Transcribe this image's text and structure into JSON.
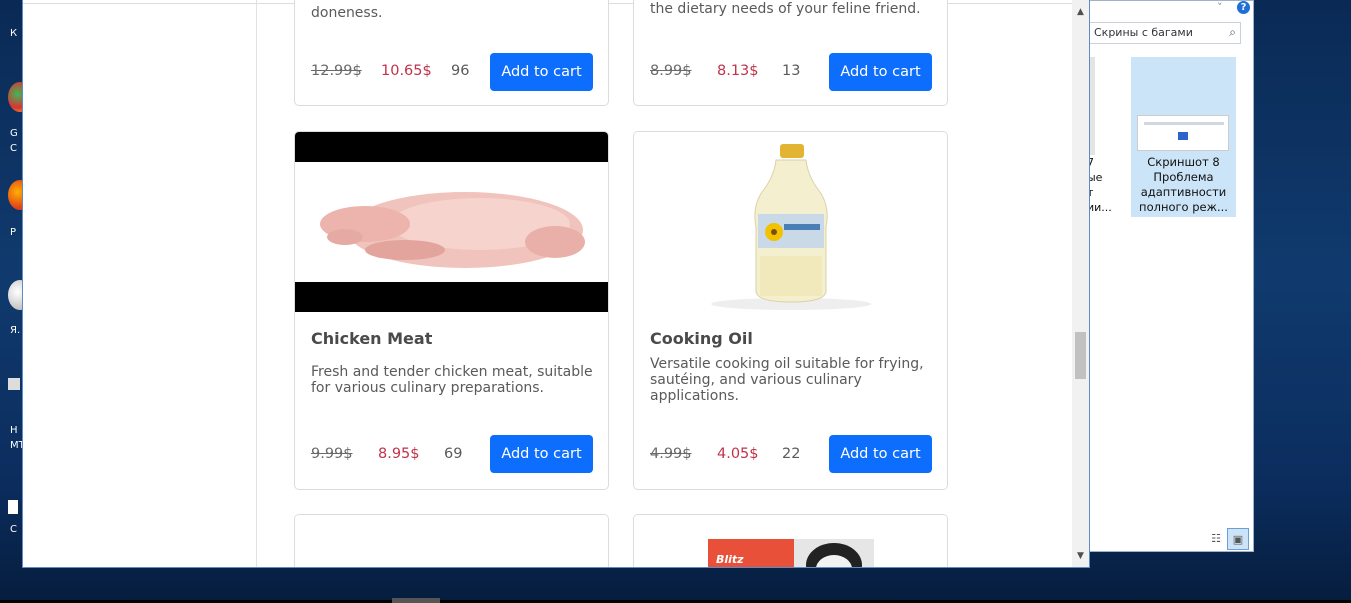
{
  "desktop": {
    "icon_labels": [
      "К",
      "G",
      "С",
      "Р",
      "Я.",
      "Н",
      "МТ",
      "С"
    ]
  },
  "explorer": {
    "search_placeholder": "Скрины с багами",
    "partial_item_caption": "7\nые\nт\nии...",
    "item": {
      "caption_line1": "Скриншот 8",
      "caption_line2": "Проблема",
      "caption_line3": "адаптивности",
      "caption_line4": "полного реж..."
    },
    "help_glyph": "?",
    "chevron_glyph": "˅"
  },
  "products": {
    "row_top": [
      {
        "desc_tail": "doneness.",
        "old_price": "12.99$",
        "new_price": "10.65$",
        "stock": "96",
        "button": "Add to cart"
      },
      {
        "desc_tail": "the dietary needs of your feline friend.",
        "old_price": "8.99$",
        "new_price": "8.13$",
        "stock": "13",
        "button": "Add to cart"
      }
    ],
    "row_mid": [
      {
        "title": "Chicken Meat",
        "description": "Fresh and tender chicken meat, suitable for various culinary preparations.",
        "old_price": "9.99$",
        "new_price": "8.95$",
        "stock": "69",
        "button": "Add to cart",
        "image": "raw-chicken"
      },
      {
        "title": "Cooking Oil",
        "description": "Versatile cooking oil suitable for frying, sautéing, and various culinary applications.",
        "old_price": "4.99$",
        "new_price": "4.05$",
        "stock": "22",
        "button": "Add to cart",
        "image": "oil-bottle"
      }
    ],
    "row_bottom_partial": [
      {
        "image": "blank"
      },
      {
        "image": "pet-food-bag-blitz",
        "brand_text": "Blitz"
      }
    ]
  },
  "colors": {
    "button": "#0d6efd",
    "sale_price": "#c0334a",
    "desktop_bg": "#103a6e"
  }
}
